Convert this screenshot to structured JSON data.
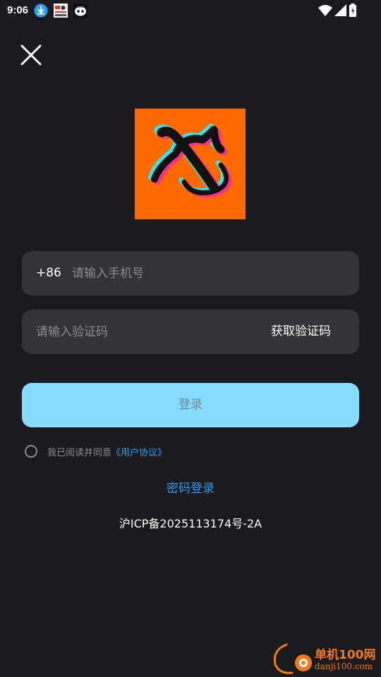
{
  "status_bar": {
    "time": "9:06",
    "notifications": [
      "download-icon",
      "app-notification-icon",
      "robot-app-icon"
    ],
    "indicators": [
      "wifi-icon",
      "signal-icon",
      "battery-icon"
    ]
  },
  "close_icon": "close-icon",
  "logo": {
    "icon": "app-logo",
    "background": "#ff6a00"
  },
  "phone_field": {
    "country_code": "+86",
    "placeholder": "请输入手机号",
    "value": ""
  },
  "code_field": {
    "placeholder": "请输入验证码",
    "value": "",
    "get_code_label": "获取验证码"
  },
  "login_button": {
    "label": "登录",
    "color": "#86dcfc"
  },
  "agreement": {
    "checked": false,
    "text": "我已阅读并同意",
    "link": "《用户协议》"
  },
  "password_login_label": "密码登录",
  "icp_text": "沪ICP备2025113174号-2A",
  "watermark": {
    "logo_text": "单机100网",
    "url_text": "danji100.com"
  },
  "colors": {
    "background": "#1b1b1f",
    "field_background": "#343438",
    "accent_link": "#2d9cf0"
  }
}
